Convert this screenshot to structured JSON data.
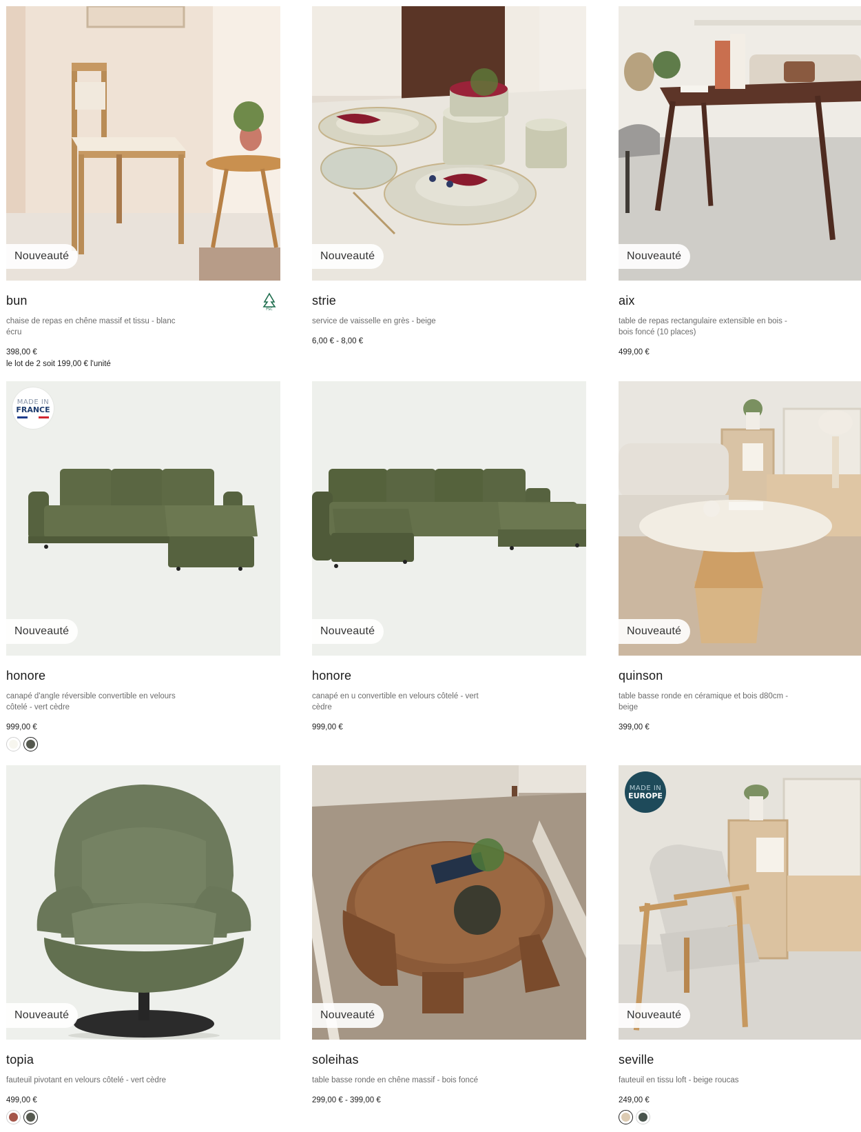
{
  "badge_new": "Nouveauté",
  "origin_badges": {
    "france": {
      "line1": "MADE IN",
      "line2": "FRANCE"
    },
    "europe": {
      "line1": "MADE IN",
      "line2": "EUROPE"
    }
  },
  "products": [
    {
      "name": "bun",
      "desc": "chaise de repas en chêne massif et tissu - blanc écru",
      "price": "398,00 €",
      "lot": "le lot de 2 soit 199,00 € l'unité",
      "badge": "fsc-icon",
      "image": "dining-chair-oak"
    },
    {
      "name": "strie",
      "desc": "service de vaisselle en grès - beige",
      "price": "6,00 € - 8,00 €",
      "image": "stoneware-tableware"
    },
    {
      "name": "aix",
      "desc": "table de repas rectangulaire extensible en bois - bois foncé (10 places)",
      "price": "499,00 €",
      "image": "dining-table-dark-wood"
    },
    {
      "name": "honore",
      "desc": "canapé d'angle réversible convertible en velours côtelé - vert cèdre",
      "price": "999,00 €",
      "image": "corner-sofa-green",
      "swatches": [
        {
          "color": "#f7f6ef",
          "selected": false
        },
        {
          "color": "#55594f",
          "selected": true
        }
      ]
    },
    {
      "name": "honore",
      "desc": "canapé en u convertible en velours côtelé - vert cèdre",
      "price": "999,00 €",
      "image": "u-sofa-green"
    },
    {
      "name": "quinson",
      "desc": "table basse ronde en céramique et bois d80cm - beige",
      "price": "399,00 €",
      "image": "round-coffee-table-ceramic"
    },
    {
      "name": "topia",
      "desc": "fauteuil pivotant en velours côtelé - vert cèdre",
      "price": "499,00 €",
      "image": "swivel-armchair-green",
      "swatches": [
        {
          "color": "#a5564a",
          "selected": false
        },
        {
          "color": "#55594f",
          "selected": true
        }
      ]
    },
    {
      "name": "soleihas",
      "desc": "table basse ronde en chêne massif - bois foncé",
      "price": "299,00 € - 399,00 €",
      "image": "round-coffee-table-oak"
    },
    {
      "name": "seville",
      "desc": "fauteuil en tissu loft - beige roucas",
      "price": "249,00 €",
      "image": "fabric-armchair-beige",
      "swatches": [
        {
          "color": "#dccbb3",
          "selected": true
        },
        {
          "color": "#4a554e",
          "selected": false
        }
      ]
    }
  ],
  "colors": {
    "sage_bg": "#eef0ec",
    "sofa_green": "#5e6a45",
    "chair_green": "#6d7a5c",
    "origin_blue": "#1e4a5a"
  }
}
